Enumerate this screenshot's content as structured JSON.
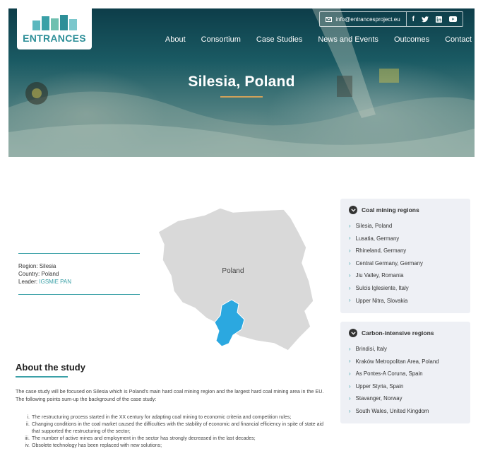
{
  "header": {
    "logo_text": "ENTRANCES",
    "email": "info@entrancesproject.eu",
    "social_icons": [
      "facebook-icon",
      "twitter-icon",
      "linkedin-icon",
      "youtube-icon"
    ]
  },
  "nav": {
    "items": [
      "About",
      "Consortium",
      "Case Studies",
      "News and Events",
      "Outcomes",
      "Contact"
    ]
  },
  "hero": {
    "title": "Silesia, Poland"
  },
  "info": {
    "region": "Region: Silesia",
    "country": "Country: Poland",
    "leader_label": "Leader:",
    "leader_link": "IGSMiE PAN"
  },
  "map": {
    "label": "Poland",
    "highlight_color": "#2ba8e0",
    "base_color": "#d9d9d9"
  },
  "about": {
    "title": "About the study",
    "paragraph": "The case study will be focused on Silesia which is Poland's main hard coal mining region and the largest hard coal mining area in the EU. The following points sum-up the background of the case study:",
    "points": [
      {
        "num": "i.",
        "text": "The restructuring process started in the XX century for adapting coal mining to economic criteria and competition rules;"
      },
      {
        "num": "ii.",
        "text": "Changing conditions in the coal market caused the difficulties with the stability of economic and financial efficiency in spite of state aid that supported the restructuring of the sector;"
      },
      {
        "num": "iii.",
        "text": "The number of active mines and employment in the sector has strongly decreased in the last decades;"
      },
      {
        "num": "iv.",
        "text": "Obsolete technology has been replaced with new solutions;"
      }
    ]
  },
  "sidebar": {
    "coal": {
      "title": "Coal mining regions",
      "items": [
        "Silesia, Poland",
        "Lusatia, Germany",
        "Rhineland, Germany",
        "Central Germany, Germany",
        "Jiu Valley, Romania",
        "Sulcis Iglesiente, Italy",
        "Upper Nitra, Slovakia"
      ]
    },
    "carbon": {
      "title": "Carbon-intensive regions",
      "items": [
        "Brindisi, Italy",
        "Kraków Metropolitan Area, Poland",
        "As Pontes-A Coruna, Spain",
        "Upper Styria, Spain",
        "Stavanger, Norway",
        "South Wales, United Kingdom"
      ]
    }
  },
  "colors": {
    "accent": "#3aa0a7",
    "card_bg": "#eef0f5"
  }
}
